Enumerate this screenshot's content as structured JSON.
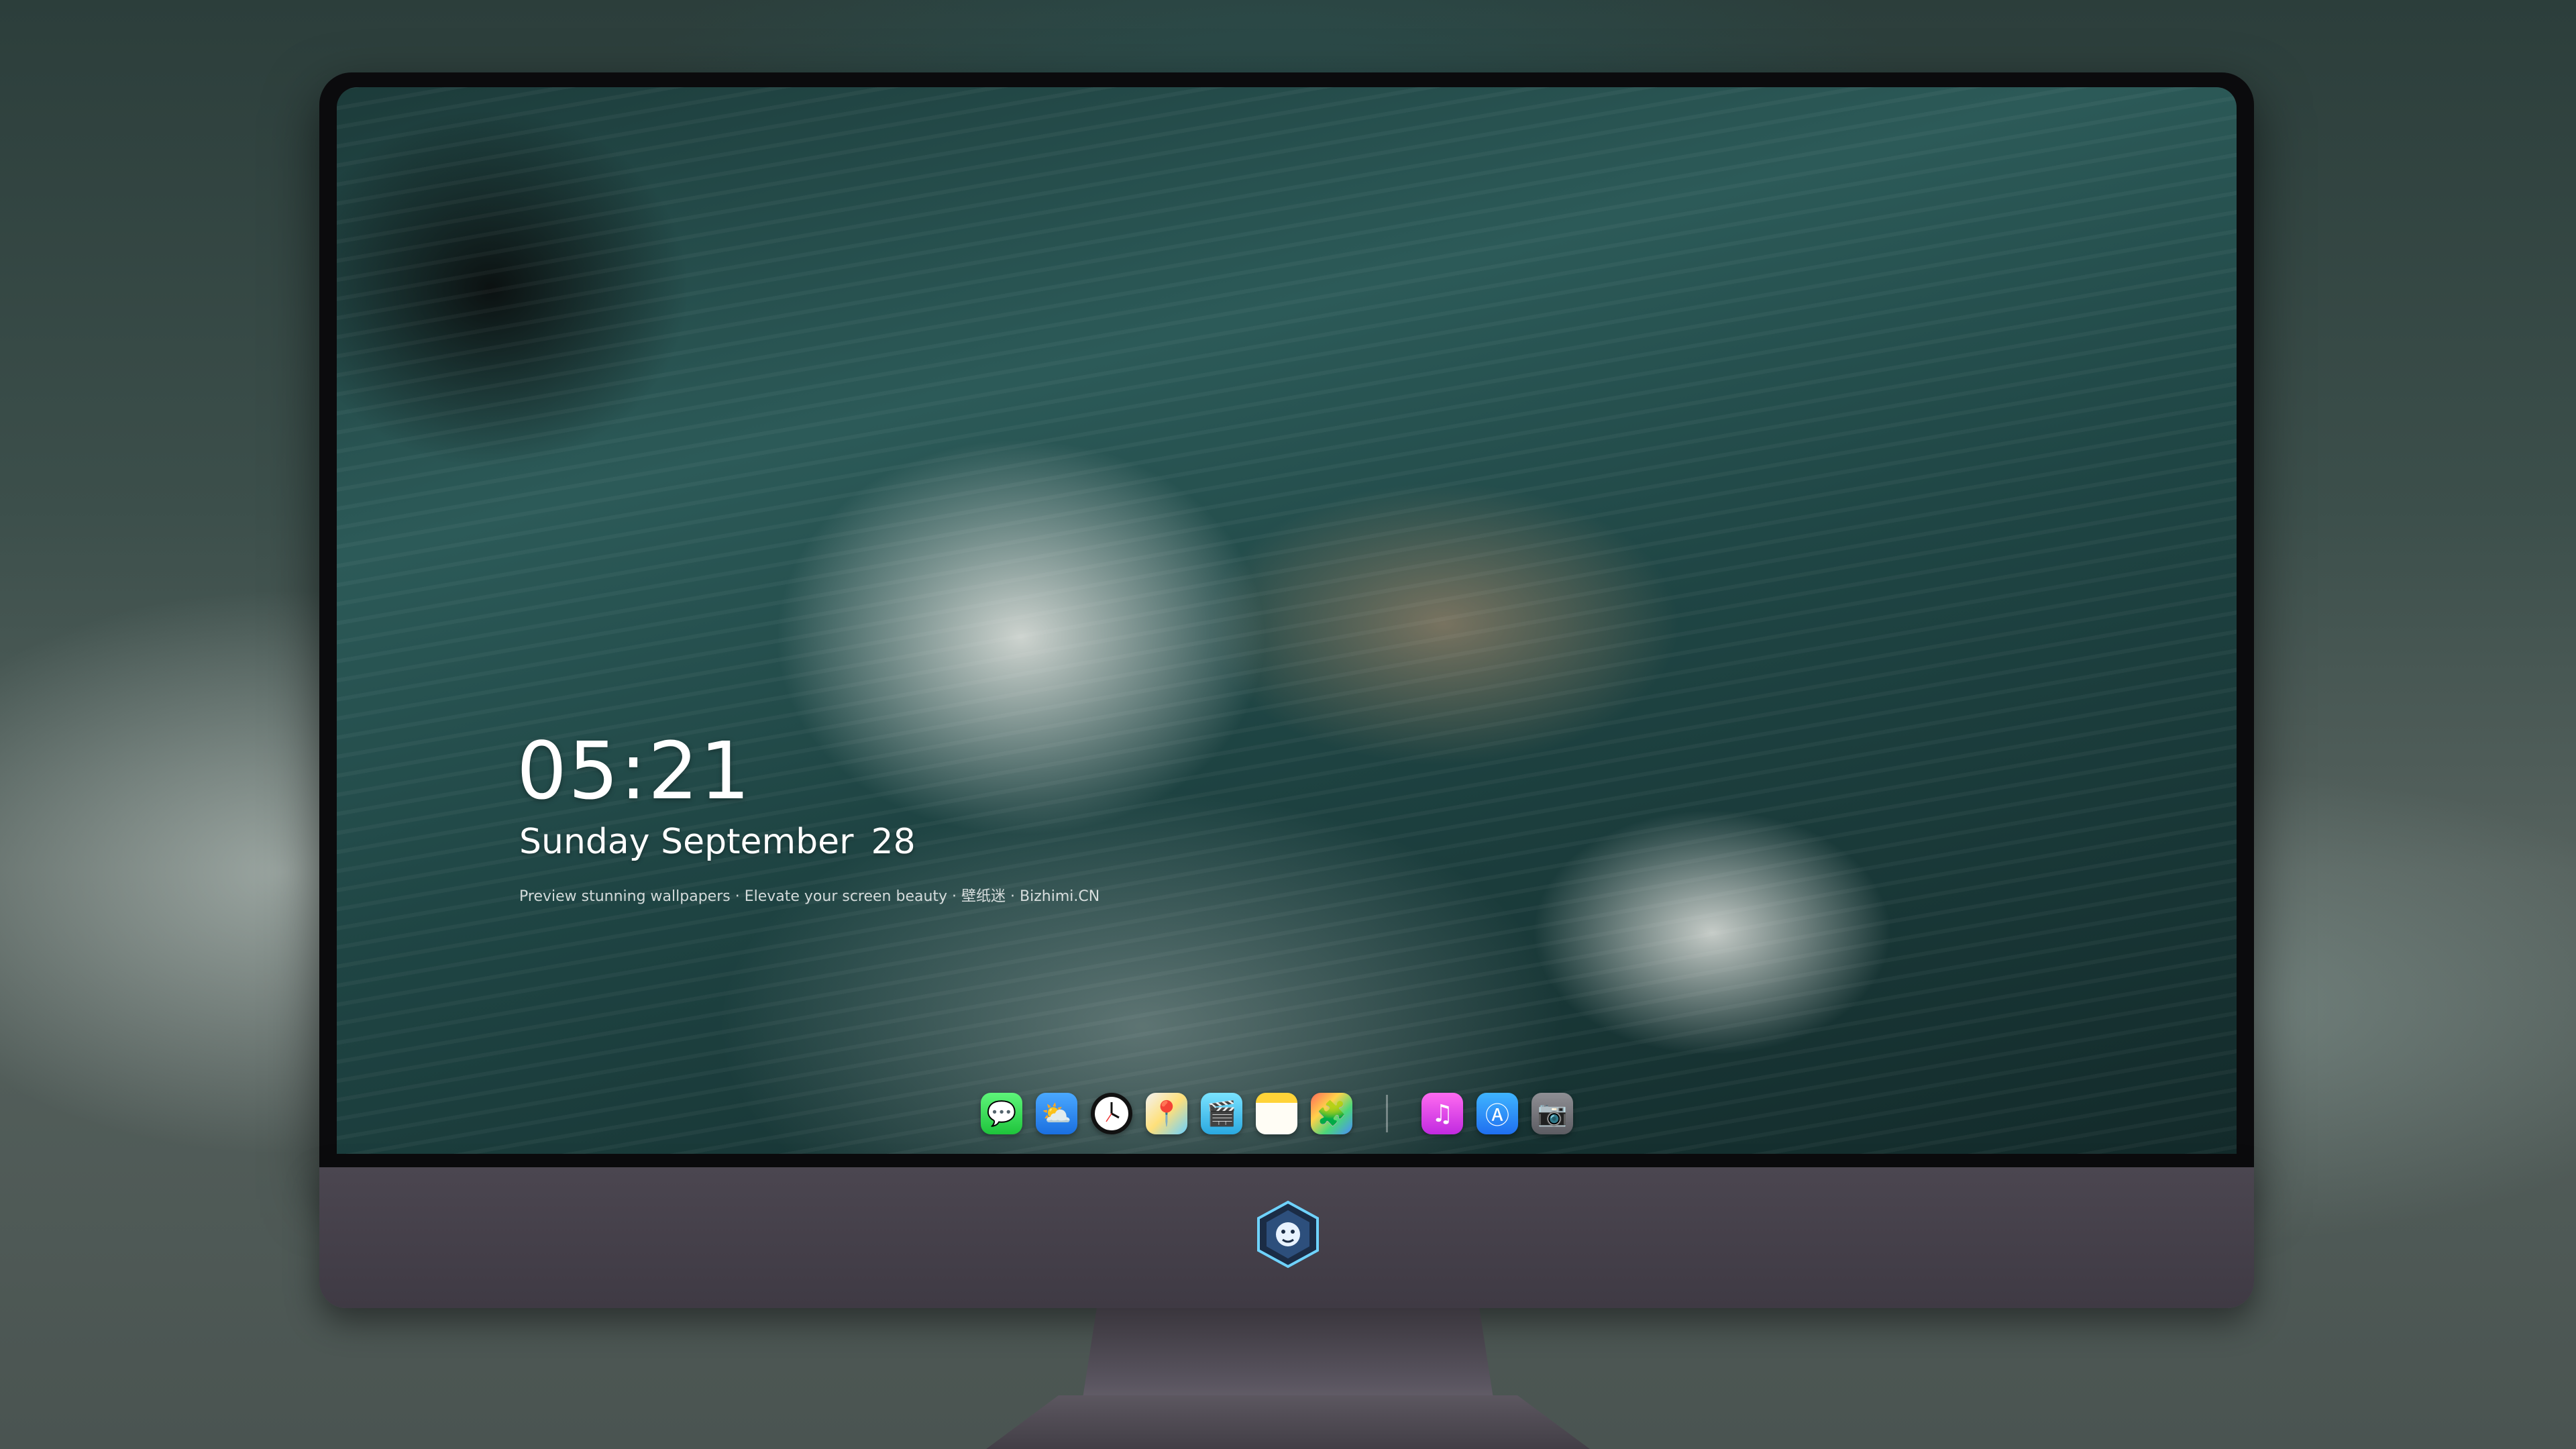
{
  "lock_screen": {
    "time": "05:21",
    "weekday_month": "Sunday September",
    "day": "28",
    "tagline": "Preview stunning wallpapers · Elevate your screen beauty · 壁纸迷 · Bizhimi.CN"
  },
  "dock": {
    "apps": [
      {
        "name": "messages-icon",
        "glyph": "💬"
      },
      {
        "name": "weather-icon",
        "glyph": "⛅"
      },
      {
        "name": "clock-icon",
        "glyph": "🕐"
      },
      {
        "name": "maps-icon",
        "glyph": "📍"
      },
      {
        "name": "video-editor-icon",
        "glyph": "🎬"
      },
      {
        "name": "notes-icon",
        "glyph": ""
      },
      {
        "name": "photos-icon",
        "glyph": "🧩"
      },
      {
        "name": "music-icon",
        "glyph": "♫"
      },
      {
        "name": "app-store-icon",
        "glyph": "Ⓐ"
      },
      {
        "name": "camera-icon",
        "glyph": "📷"
      }
    ]
  },
  "colors": {
    "chin": "#48434d",
    "bezel": "#0b0b0d",
    "text": "#ffffff"
  }
}
